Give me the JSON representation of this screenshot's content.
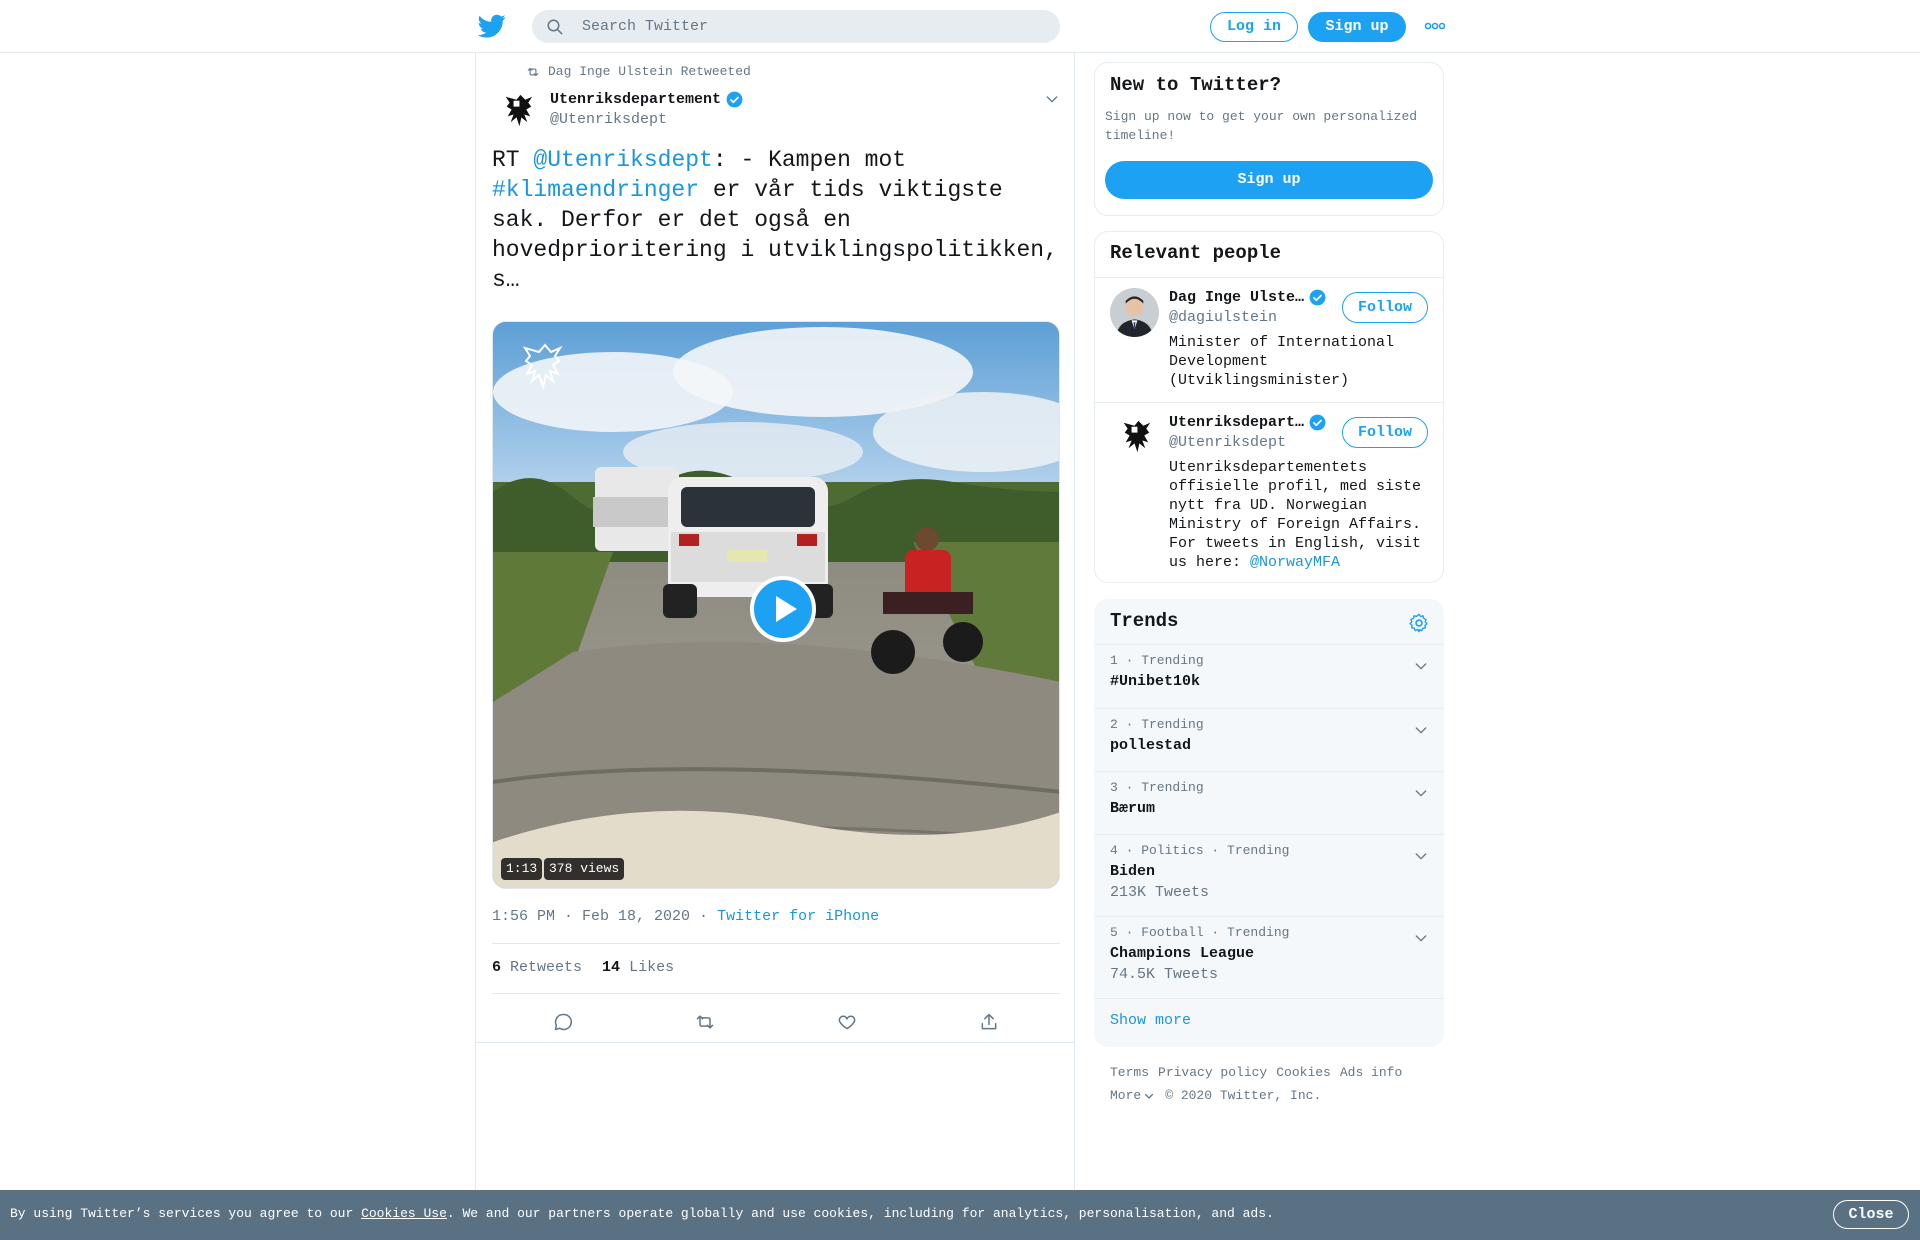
{
  "colors": {
    "brand": "#1da1f2",
    "link": "#1b95e0",
    "muted": "#657786",
    "text": "#14171a",
    "cookie_bg": "#5a7184"
  },
  "header": {
    "search_placeholder": "Search Twitter",
    "login_label": "Log in",
    "signup_label": "Sign up"
  },
  "tweet": {
    "retweeted_by": "Dag Inge Ulstein Retweeted",
    "author_name": "Utenriksdepartement",
    "author_handle": "@Utenriksdept",
    "text_rt": "RT ",
    "text_mention": "@Utenriksdept",
    "text_part1": ": - Kampen mot ",
    "text_hashtag": "#klimaendringer",
    "text_part2": " er vår tids viktigste sak. Derfor er det også en hovedprioritering i utviklingspolitikken, s…",
    "video_duration": "1:13",
    "video_views": "378 views",
    "timestamp": "1:56 PM · Feb 18, 2020",
    "timestamp_sep": " · ",
    "source": "Twitter for iPhone",
    "retweets_count": "6",
    "retweets_label": "Retweets",
    "likes_count": "14",
    "likes_label": "Likes"
  },
  "new_to_twitter": {
    "title": "New to Twitter?",
    "subtitle": "Sign up now to get your own personalized timeline!",
    "signup_label": "Sign up"
  },
  "relevant_people": {
    "title": "Relevant people",
    "people": [
      {
        "name": "Dag Inge Ulste…",
        "handle": "@dagiulstein",
        "bio": "Minister of International Development (Utviklingsminister)",
        "follow_label": "Follow"
      },
      {
        "name": "Utenriksdepart…",
        "handle": "@Utenriksdept",
        "bio": "Utenriksdepartementets offisielle profil, med siste nytt fra UD. Norwegian Ministry of Foreign Affairs. For tweets in English, visit us here: ",
        "bio_link": "@NorwayMFA",
        "follow_label": "Follow"
      }
    ]
  },
  "trends": {
    "title": "Trends",
    "items": [
      {
        "meta": "1 · Trending",
        "name": "#Unibet10k",
        "count": ""
      },
      {
        "meta": "2 · Trending",
        "name": "pollestad",
        "count": ""
      },
      {
        "meta": "3 · Trending",
        "name": "Bærum",
        "count": ""
      },
      {
        "meta": "4 · Politics · Trending",
        "name": "Biden",
        "count": "213K Tweets"
      },
      {
        "meta": "5 · Football · Trending",
        "name": "Champions League",
        "count": "74.5K Tweets"
      }
    ],
    "show_more": "Show more"
  },
  "footer": {
    "links": [
      "Terms",
      "Privacy policy",
      "Cookies",
      "Ads info"
    ],
    "more_label": "More",
    "copyright": "© 2020 Twitter, Inc."
  },
  "cookie_bar": {
    "text_before": "By using Twitter’s services you agree to our ",
    "link": "Cookies Use",
    "text_after": ". We and our partners operate globally and use cookies, including for analytics, personalisation, and ads.",
    "close_label": "Close"
  }
}
